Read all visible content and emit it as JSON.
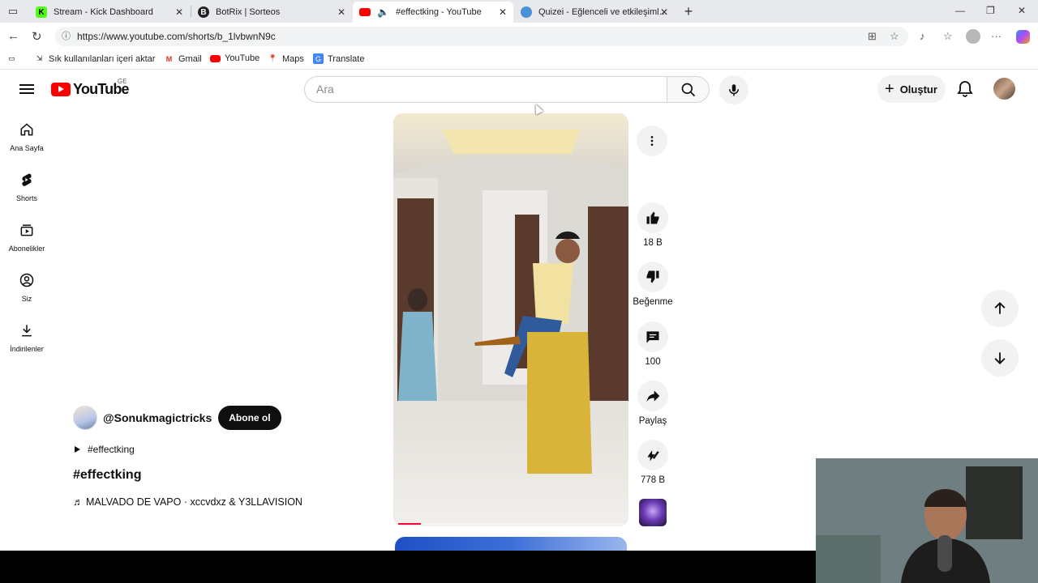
{
  "browser": {
    "tabs": [
      {
        "label": "Stream - Kick Dashboard",
        "active": false,
        "favicon": "kick-icon",
        "color": "#53fc18"
      },
      {
        "label": "BotRix | Sorteos",
        "active": false,
        "favicon": "botrix-icon",
        "color": "#222222"
      },
      {
        "label": "#effectking - YouTube",
        "active": true,
        "favicon": "youtube-icon",
        "color": "#ff0000"
      },
      {
        "label": "Quizei - Eğlenceli ve etkileşimli qu",
        "active": false,
        "favicon": "quizei-icon",
        "color": "#4a90d9"
      }
    ],
    "url": "https://www.youtube.com/shorts/b_1lvbwnN9c",
    "bookmarks": [
      {
        "label": "Sık kullanılanları içeri aktar",
        "icon": "import-icon"
      },
      {
        "label": "Gmail",
        "icon": "gmail-icon"
      },
      {
        "label": "YouTube",
        "icon": "youtube-icon"
      },
      {
        "label": "Maps",
        "icon": "maps-icon"
      },
      {
        "label": "Translate",
        "icon": "translate-icon"
      }
    ]
  },
  "youtube": {
    "logo_text": "YouTube",
    "country_code": "GE",
    "search_placeholder": "Ara",
    "create_label": "Oluştur",
    "sidebar": [
      {
        "label": "Ana Sayfa",
        "icon": "home-icon"
      },
      {
        "label": "Shorts",
        "icon": "shorts-icon"
      },
      {
        "label": "Abonelikler",
        "icon": "subscriptions-icon"
      },
      {
        "label": "Siz",
        "icon": "you-icon"
      },
      {
        "label": "İndirilenler",
        "icon": "downloads-icon"
      }
    ],
    "short": {
      "channel": "@Sonukmagictricks",
      "subscribe_label": "Abone ol",
      "hashtag": "#effectking",
      "title": "#effectking",
      "music": "♬ MALVADO DE VAPO · xccvdxz & Y3LLAVISION",
      "progress": 0.1
    },
    "actions": {
      "likes": "18 B",
      "dislike_label": "Beğenme",
      "comments": "100",
      "share_label": "Paylaş",
      "remix": "778 B"
    }
  }
}
